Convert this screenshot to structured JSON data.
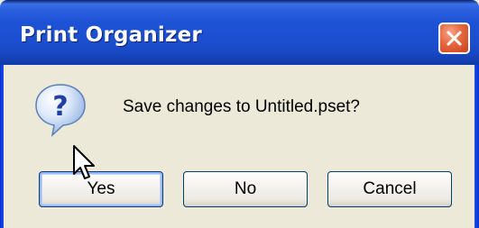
{
  "window": {
    "title": "Print Organizer",
    "close_icon": "close-icon",
    "accent_color": "#2A5FDE"
  },
  "dialog": {
    "icon": "question-icon",
    "message": "Save changes to Untitled.pset?"
  },
  "buttons": {
    "yes": "Yes",
    "no": "No",
    "cancel": "Cancel",
    "default": "yes"
  },
  "cursor": {
    "icon": "mouse-pointer-icon"
  }
}
